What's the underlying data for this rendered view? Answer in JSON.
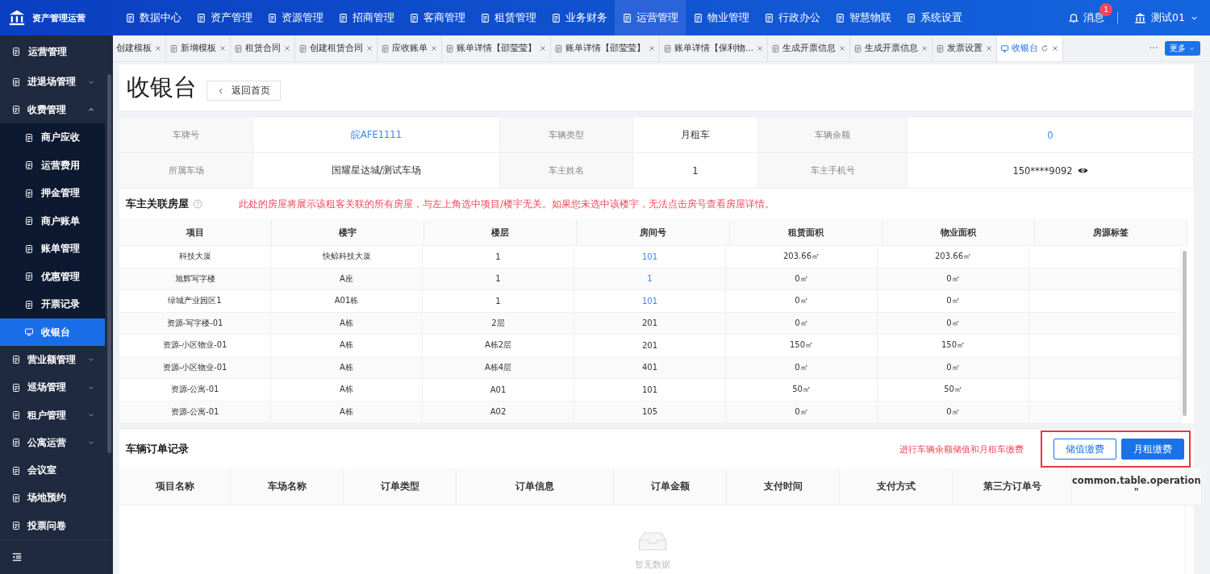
{
  "app": {
    "title": "资产管理运营"
  },
  "top_nav": [
    {
      "label": "数据中心",
      "selected": false
    },
    {
      "label": "资产管理",
      "selected": false
    },
    {
      "label": "资源管理",
      "selected": false
    },
    {
      "label": "招商管理",
      "selected": false
    },
    {
      "label": "客商管理",
      "selected": false
    },
    {
      "label": "租赁管理",
      "selected": false
    },
    {
      "label": "业务财务",
      "selected": false
    },
    {
      "label": "运营管理",
      "selected": true
    },
    {
      "label": "物业管理",
      "selected": false
    },
    {
      "label": "行政办公",
      "selected": false
    },
    {
      "label": "智慧物联",
      "selected": false
    },
    {
      "label": "系统设置",
      "selected": false
    }
  ],
  "header_right": {
    "messages": {
      "label": "消息",
      "badge": "1"
    },
    "user": "测试01"
  },
  "sidebar": {
    "title": "运营管理",
    "items": [
      {
        "label": "进退场管理",
        "expanded": false,
        "selected": false
      },
      {
        "label": "收费管理",
        "expanded": true,
        "selected": false,
        "children": [
          {
            "label": "商户应收",
            "selected": false
          },
          {
            "label": "运营费用",
            "selected": false
          },
          {
            "label": "押金管理",
            "selected": false
          },
          {
            "label": "商户账单",
            "selected": false
          },
          {
            "label": "账单管理",
            "selected": false
          },
          {
            "label": "优惠管理",
            "selected": false
          },
          {
            "label": "开票记录",
            "selected": false
          },
          {
            "label": "收银台",
            "selected": true
          }
        ]
      },
      {
        "label": "营业额管理",
        "expanded": false,
        "selected": false
      },
      {
        "label": "巡场管理",
        "expanded": false,
        "selected": false
      },
      {
        "label": "租户管理",
        "expanded": false,
        "selected": false
      },
      {
        "label": "公寓运营",
        "expanded": false,
        "selected": false
      },
      {
        "label": "会议室",
        "selected": false
      },
      {
        "label": "场地预约",
        "selected": false
      },
      {
        "label": "投票问卷",
        "selected": false
      }
    ]
  },
  "tabs": [
    {
      "label": "创建模板",
      "selected": false
    },
    {
      "label": "新增模板",
      "selected": false
    },
    {
      "label": "租赁合同",
      "selected": false
    },
    {
      "label": "创建租赁合同",
      "selected": false
    },
    {
      "label": "应收账单",
      "selected": false
    },
    {
      "label": "账单详情【邵莹莹】",
      "selected": false
    },
    {
      "label": "账单详情【邵莹莹】",
      "selected": false
    },
    {
      "label": "账单详情【保利物...",
      "selected": false
    },
    {
      "label": "生成开票信息",
      "selected": false
    },
    {
      "label": "生成开票信息",
      "selected": false
    },
    {
      "label": "发票设置",
      "selected": false
    },
    {
      "label": "收银台",
      "selected": true
    }
  ],
  "tab_overflow": "···",
  "more_button": "更多",
  "page": {
    "title": "收银台",
    "back_button": "返回首页"
  },
  "vehicle_info": [
    {
      "label": "车牌号",
      "value": "皖AFE1111",
      "kind": "link"
    },
    {
      "label": "车辆类型",
      "value": "月租车",
      "kind": "text"
    },
    {
      "label": "车辆余额",
      "value": "0",
      "kind": "link"
    },
    {
      "label": "所属车场",
      "value": "国耀星达城/测试车场",
      "kind": "text"
    },
    {
      "label": "车主姓名",
      "value": "1",
      "kind": "text"
    },
    {
      "label": "车主手机号",
      "value": "150****9092",
      "kind": "masked"
    }
  ],
  "houses": {
    "title": "车主关联房屋",
    "notice": "此处的房屋将展示该租客关联的所有房屋，与左上角选中项目/楼宇无关。如果您未选中该楼宇，无法点击房号查看房屋详情。",
    "columns": [
      "项目",
      "楼宇",
      "楼层",
      "房间号",
      "租赁面积",
      "物业面积",
      "房源标签"
    ],
    "rows": [
      {
        "cells": [
          "科技大厦",
          "快鲸科技大厦",
          "1",
          "101",
          "203.66㎡",
          "203.66㎡"
        ],
        "room_linked": true
      },
      {
        "cells": [
          "旭辉写字楼",
          "A座",
          "1",
          "1",
          "0㎡",
          "0㎡"
        ],
        "room_linked": true
      },
      {
        "cells": [
          "绿城产业园区1",
          "A01栋",
          "1",
          "101",
          "0㎡",
          "0㎡"
        ],
        "room_linked": true
      },
      {
        "cells": [
          "资源-写字楼-01",
          "A栋",
          "2层",
          "201",
          "0㎡",
          "0㎡"
        ],
        "room_linked": false
      },
      {
        "cells": [
          "资源-小区物业-01",
          "A栋",
          "A栋2层",
          "201",
          "150㎡",
          "150㎡"
        ],
        "room_linked": false
      },
      {
        "cells": [
          "资源-小区物业-01",
          "A栋",
          "A栋4层",
          "401",
          "0㎡",
          "0㎡"
        ],
        "room_linked": false
      },
      {
        "cells": [
          "资源-公寓-01",
          "A栋",
          "A01",
          "101",
          "50㎡",
          "50㎡"
        ],
        "room_linked": false
      },
      {
        "cells": [
          "资源-公寓-01",
          "A栋",
          "A02",
          "105",
          "0㎡",
          "0㎡"
        ],
        "room_linked": false
      }
    ]
  },
  "orders": {
    "title": "车辆订单记录",
    "hint": "进行车辆余额储值和月租车缴费",
    "highlighted": true,
    "buttons": [
      {
        "label": "储值缴费",
        "kind": "secondary"
      },
      {
        "label": "月租缴费",
        "kind": "primary"
      }
    ],
    "columns": [
      "项目名称",
      "车场名称",
      "订单类型",
      "订单信息",
      "订单金额",
      "支付时间",
      "支付方式",
      "第三方订单号",
      "common.table.operation\n\""
    ],
    "empty_text": "暂无数据"
  }
}
